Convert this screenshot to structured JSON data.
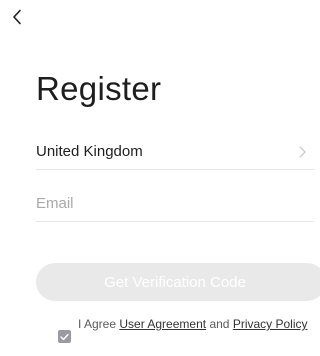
{
  "nav": {
    "back_icon": "chevron-left-icon"
  },
  "page": {
    "title": "Register"
  },
  "country": {
    "value": "United Kingdom",
    "chevron_icon": "chevron-right-icon"
  },
  "email": {
    "placeholder": "Email",
    "value": ""
  },
  "verify_button": {
    "label": "Get Verification Code",
    "enabled": false
  },
  "agreement": {
    "checked": true,
    "prefix": "I Agree",
    "user_agreement": "User Agreement",
    "conjunction": "and",
    "privacy_policy": "Privacy Policy"
  },
  "colors": {
    "text": "#1e1e1e",
    "placeholder": "#a9a9a9",
    "divider": "#e6e6e6",
    "button_disabled": "#e9e9e9",
    "checkbox": "#9a9aa0"
  }
}
